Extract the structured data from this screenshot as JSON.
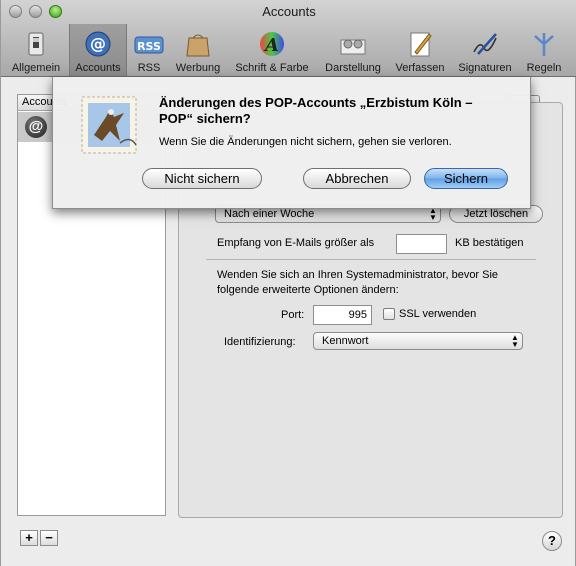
{
  "window": {
    "title": "Accounts"
  },
  "toolbar": {
    "items": [
      {
        "label": "Allgemein",
        "icon": "switch-icon"
      },
      {
        "label": "Accounts",
        "icon": "at-sign-icon",
        "selected": true
      },
      {
        "label": "RSS",
        "icon": "rss-icon"
      },
      {
        "label": "Werbung",
        "icon": "junk-bag-icon"
      },
      {
        "label": "Schrift & Farbe",
        "icon": "font-color-icon"
      },
      {
        "label": "Darstellung",
        "icon": "viewing-icon"
      },
      {
        "label": "Verfassen",
        "icon": "compose-pen-icon"
      },
      {
        "label": "Signaturen",
        "icon": "signature-icon"
      },
      {
        "label": "Regeln",
        "icon": "rules-icon"
      }
    ]
  },
  "accounts_list": {
    "header": "Accounts",
    "selected_icon": "at-sign-icon",
    "add_label": "+",
    "remove_label": "−"
  },
  "settings": {
    "remove_after_value": "Nach einer Woche",
    "remove_now_label": "Jetzt löschen",
    "size_limit_label": "Empfang von E-Mails größer als",
    "size_limit_value": "",
    "size_limit_suffix": "KB bestätigen",
    "advanced_note": "Wenden Sie sich an Ihren Systemadministrator, bevor Sie folgende erweiterte Optionen ändern:",
    "port_label": "Port:",
    "port_value": "995",
    "ssl_label": "SSL verwenden",
    "auth_label": "Identifizierung:",
    "auth_value": "Kennwort"
  },
  "dialog": {
    "title": "Änderungen des POP-Accounts „Erzbistum Köln – POP“ sichern?",
    "message": "Wenn Sie die Änderungen nicht sichern, gehen sie verloren.",
    "dont_save_label": "Nicht sichern",
    "cancel_label": "Abbrechen",
    "save_label": "Sichern",
    "icon": "mail-stamp-eagle-icon"
  },
  "help": {
    "label": "?"
  },
  "colors": {
    "default_button": "#6aa8e8",
    "toolbar_top": "#d3d3d3",
    "toolbar_bottom": "#a8a8a8"
  }
}
